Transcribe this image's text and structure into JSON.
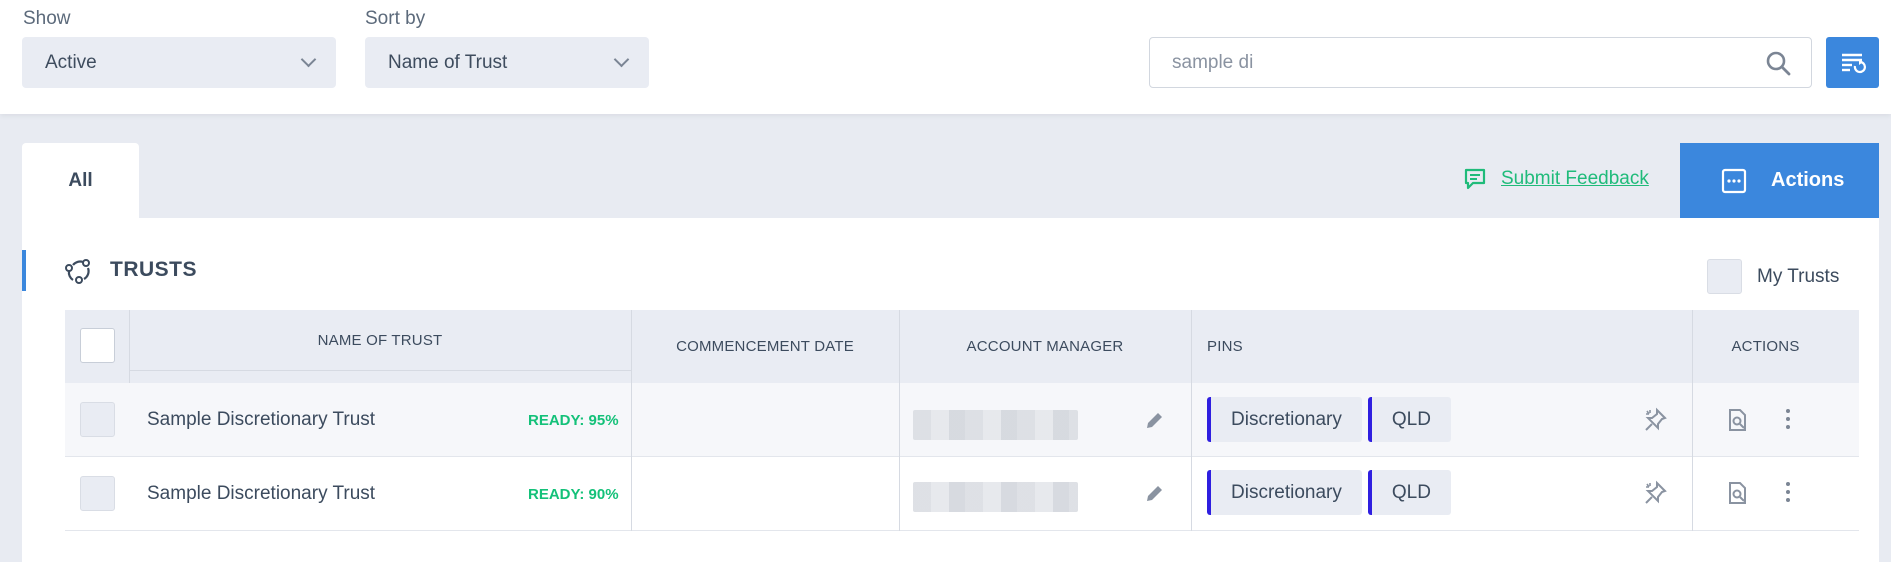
{
  "filters": {
    "show_label": "Show",
    "show_value": "Active",
    "sort_label": "Sort by",
    "sort_value": "Name of Trust",
    "search_value": "sample di"
  },
  "tabs": {
    "all_label": "All"
  },
  "feedback": {
    "label": "Submit Feedback"
  },
  "actions_button": {
    "label": "Actions"
  },
  "section": {
    "title": "TRUSTS",
    "my_trusts_label": "My Trusts"
  },
  "table": {
    "headers": {
      "name": "NAME OF TRUST",
      "commencement": "COMMENCEMENT DATE",
      "manager": "ACCOUNT MANAGER",
      "pins": "PINS",
      "actions": "ACTIONS"
    },
    "rows": [
      {
        "name": "Sample Discretionary Trust",
        "ready": "READY: 95%",
        "pins": [
          "Discretionary",
          "QLD"
        ]
      },
      {
        "name": "Sample Discretionary Trust",
        "ready": "READY: 90%",
        "pins": [
          "Discretionary",
          "QLD"
        ]
      }
    ]
  },
  "colors": {
    "accent": "#3b87dd",
    "ready_green": "#14c179",
    "pin_border": "#2f1fe0",
    "feedback_green": "#1fbb7a"
  },
  "icons": [
    "chevron-down-icon",
    "search-icon",
    "filter-list-icon",
    "feedback-icon",
    "ellipsis-square-icon",
    "trust-network-icon",
    "pencil-icon",
    "pin-icon",
    "document-search-icon",
    "vertical-dots-icon"
  ]
}
